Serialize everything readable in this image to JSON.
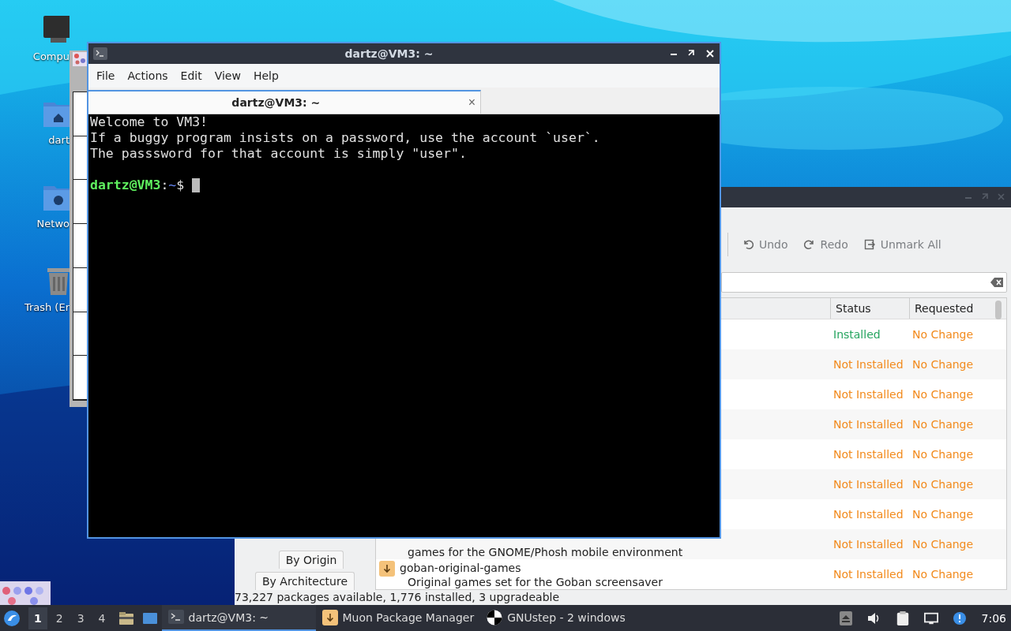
{
  "desktop_icons": [
    {
      "label": "Compu",
      "kind": "computer"
    },
    {
      "label": "dart",
      "kind": "home"
    },
    {
      "label": "Netwo",
      "kind": "network"
    },
    {
      "label": "Trash (Er",
      "kind": "trash"
    }
  ],
  "terminal": {
    "title": "dartz@VM3: ~",
    "menu": [
      "File",
      "Actions",
      "Edit",
      "View",
      "Help"
    ],
    "tab": {
      "label": "dartz@VM3: ~",
      "close": "×"
    },
    "lines": [
      "Welcome to VM3!",
      "If a buggy program insists on a password, use the account `user`.",
      "The passsword for that account is simply \"user\"."
    ],
    "prompt": [
      {
        "text": "dartz@VM3",
        "kind": "user"
      },
      {
        "text": ":",
        "kind": "plain"
      },
      {
        "text": "~",
        "kind": "path"
      },
      {
        "text": "$",
        "kind": "plain"
      }
    ]
  },
  "package_manager": {
    "toolbar": [
      {
        "label": "Undo",
        "kind": "undo"
      },
      {
        "label": "Redo",
        "kind": "redo"
      },
      {
        "label": "Unmark All",
        "kind": "unmark"
      }
    ],
    "columns": [
      "Status",
      "Requested"
    ],
    "rows": [
      {
        "status": "Installed",
        "color": "#27a560",
        "requested": "No Change"
      },
      {
        "status": "Not Installed",
        "color": "#f28a1c",
        "requested": "No Change"
      },
      {
        "status": "Not Installed",
        "color": "#f28a1c",
        "requested": "No Change"
      },
      {
        "status": "Not Installed",
        "color": "#f28a1c",
        "requested": "No Change"
      },
      {
        "status": "Not Installed",
        "color": "#f28a1c",
        "requested": "No Change"
      },
      {
        "status": "Not Installed",
        "color": "#f28a1c",
        "requested": "No Change"
      },
      {
        "status": "Not Installed",
        "color": "#f28a1c",
        "requested": "No Change"
      },
      {
        "description": "games for the GNOME/Phosh mobile environment",
        "status": "Not Installed",
        "color": "#f28a1c",
        "requested": "No Change"
      },
      {
        "name": "goban-original-games",
        "description": "Original games set for the Goban screensaver",
        "status": "Not Installed",
        "color": "#f28a1c",
        "requested": "No Change"
      }
    ],
    "filter_tabs": [
      "By Origin",
      "By Architecture"
    ],
    "status_bar": "73,227 packages available, 1,776 installed, 3 upgradeable"
  },
  "taskbar": {
    "workspaces": [
      {
        "label": "1",
        "selected": true
      },
      {
        "label": "2",
        "selected": false
      },
      {
        "label": "3",
        "selected": false
      },
      {
        "label": "4",
        "selected": false
      }
    ],
    "tasks": [
      {
        "label": "dartz@VM3: ~",
        "kind": "terminal",
        "selected": true
      },
      {
        "label": "Muon Package Manager",
        "kind": "package",
        "selected": false
      },
      {
        "label": "GNUstep - 2 windows",
        "kind": "gnustep",
        "selected": false
      }
    ],
    "clock": "7:06"
  }
}
